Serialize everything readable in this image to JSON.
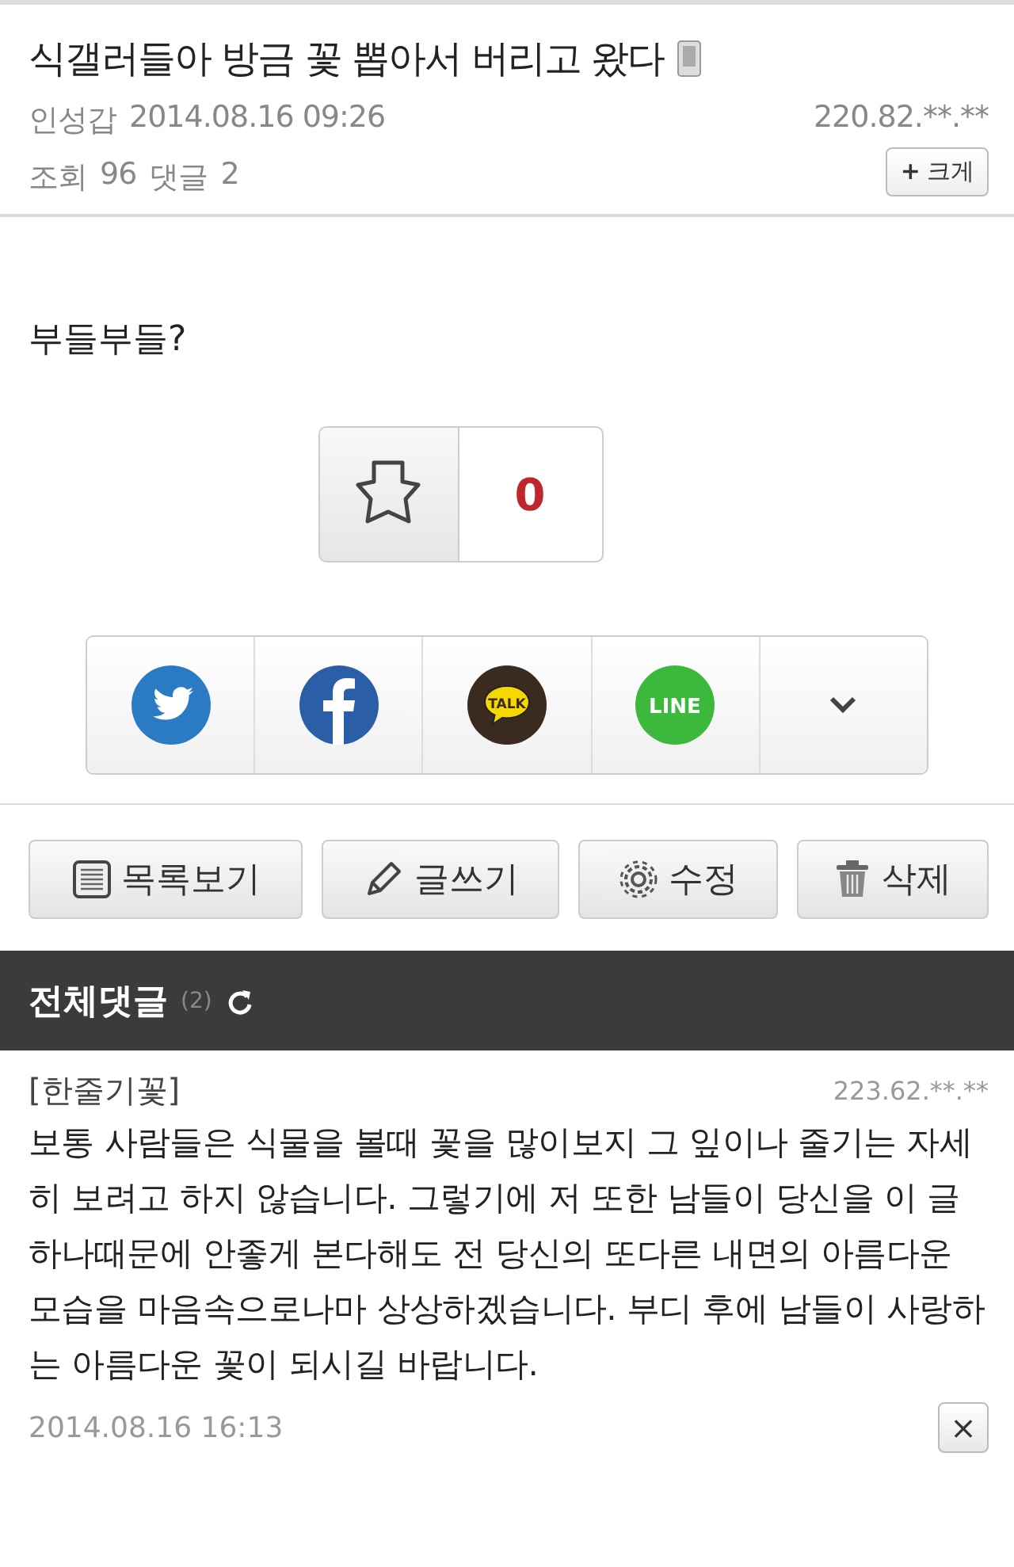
{
  "post": {
    "title": "식갤러들아 방금 꽃 뽑아서 버리고 왔다",
    "author": "인성갑",
    "date": "2014.08.16 09:26",
    "ip": "220.82.**.**",
    "views_label": "조회",
    "views": "96",
    "comments_label": "댓글",
    "comments": "2",
    "zoom_button": {
      "icon": "+",
      "label": "크게"
    },
    "body": "부들부들?"
  },
  "recommend": {
    "count": "0"
  },
  "share": [
    {
      "kind": "twitter"
    },
    {
      "kind": "facebook"
    },
    {
      "kind": "kakaotalk",
      "label": "TALK"
    },
    {
      "kind": "line",
      "label": "LINE"
    },
    {
      "kind": "more"
    }
  ],
  "actions": [
    {
      "kind": "list",
      "label": "목록보기"
    },
    {
      "kind": "write",
      "label": "글쓰기"
    },
    {
      "kind": "edit",
      "label": "수정"
    },
    {
      "kind": "delete",
      "label": "삭제"
    }
  ],
  "comments_header": {
    "title": "전체댓글",
    "count": "(2)"
  },
  "comments": [
    {
      "author": "[한줄기꽃]",
      "ip": "223.62.**.**",
      "text": "보통 사람들은 식물을 볼때 꽃을 많이보지 그 잎이나 줄기는 자세히 보려고 하지 않습니다. 그렇기에 저 또한 남들이 당신을 이 글 하나때문에 안좋게 본다해도 전 당신의 또다른 내면의 아름다운 모습을 마음속으로나마 상상하겠습니다. 부디 후에 남들이 사랑하는 아름다운 꽃이 되시길 바랍니다.",
      "date": "2014.08.16 16:13",
      "delete": "×"
    }
  ]
}
